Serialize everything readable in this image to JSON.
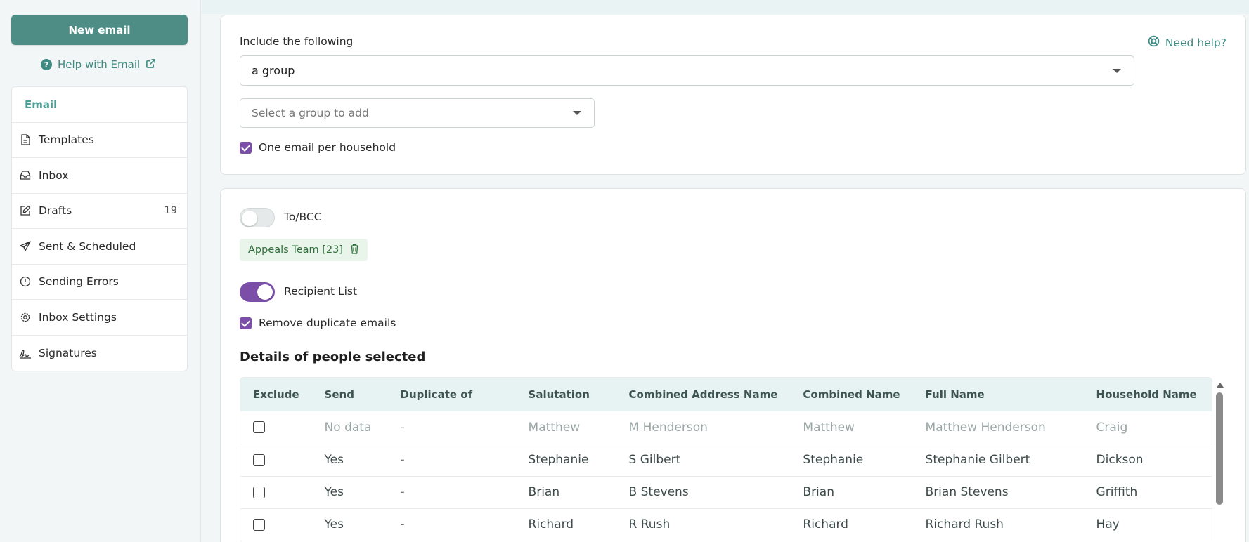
{
  "sidebar": {
    "new_email_label": "New email",
    "help_label": "Help with Email",
    "items": [
      {
        "label": "Email",
        "icon": "none"
      },
      {
        "label": "Templates",
        "icon": "document-icon"
      },
      {
        "label": "Inbox",
        "icon": "inbox-icon"
      },
      {
        "label": "Drafts",
        "icon": "edit-icon",
        "count": "19"
      },
      {
        "label": "Sent & Scheduled",
        "icon": "send-icon"
      },
      {
        "label": "Sending Errors",
        "icon": "error-icon"
      },
      {
        "label": "Inbox Settings",
        "icon": "gear-icon"
      },
      {
        "label": "Signatures",
        "icon": "signature-icon"
      }
    ]
  },
  "include": {
    "label": "Include the following",
    "need_help": "Need help?",
    "selected": "a group",
    "group_placeholder": "Select a group to add",
    "household_label": "One email per household",
    "household_checked": true
  },
  "recipients": {
    "to_bcc_label": "To/BCC",
    "to_bcc_on": false,
    "chip_label": "Appeals Team [23]",
    "recipient_list_label": "Recipient List",
    "recipient_list_on": true,
    "remove_duplicates_label": "Remove duplicate emails",
    "remove_duplicates_checked": true,
    "section_title": "Details of people selected",
    "columns": [
      "Exclude",
      "Send",
      "Duplicate of",
      "Salutation",
      "Combined Address Name",
      "Combined Name",
      "Full Name",
      "Household Name"
    ],
    "rows": [
      {
        "send": "No data",
        "dup": "-",
        "salutation": "Matthew",
        "address": "M Henderson",
        "combined": "Matthew",
        "full": "Matthew Henderson",
        "household": "Craig",
        "muted": true
      },
      {
        "send": "Yes",
        "dup": "-",
        "salutation": "Stephanie",
        "address": "S Gilbert",
        "combined": "Stephanie",
        "full": "Stephanie Gilbert",
        "household": "Dickson",
        "muted": false
      },
      {
        "send": "Yes",
        "dup": "-",
        "salutation": "Brian",
        "address": "B Stevens",
        "combined": "Brian",
        "full": "Brian Stevens",
        "household": "Griffith",
        "muted": false
      },
      {
        "send": "Yes",
        "dup": "-",
        "salutation": "Richard",
        "address": "R Rush",
        "combined": "Richard",
        "full": "Richard Rush",
        "household": "Hay",
        "muted": false
      }
    ]
  },
  "colors": {
    "accent": "#4e8d86",
    "purple": "#7b4fa8",
    "link": "#3f8a82"
  }
}
